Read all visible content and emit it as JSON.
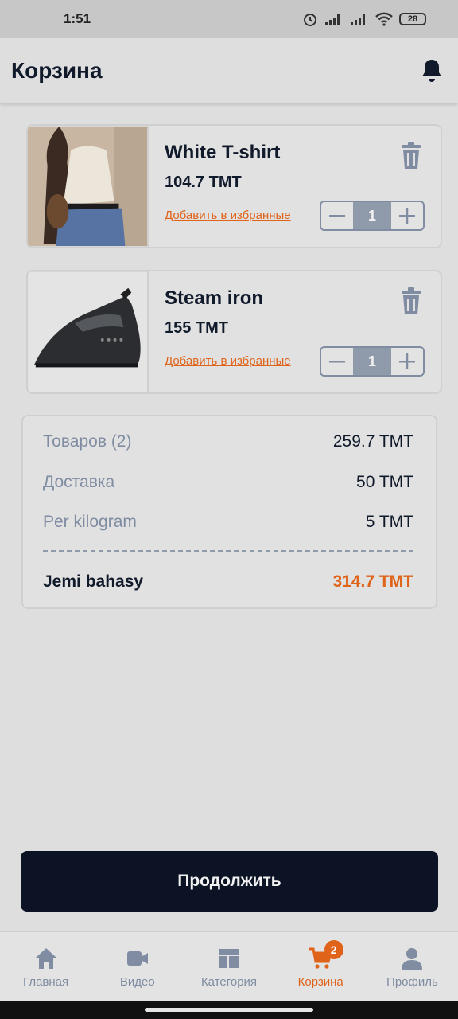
{
  "status": {
    "time": "1:51",
    "battery": "28"
  },
  "header": {
    "title": "Корзина"
  },
  "cart": {
    "items": [
      {
        "name": "White T-shirt",
        "price": "104.7 TMT",
        "fav_label": "Добавить в избранные",
        "qty": "1"
      },
      {
        "name": "Steam iron",
        "price": "155 TMT",
        "fav_label": "Добавить в избранные",
        "qty": "1"
      }
    ]
  },
  "summary": {
    "goods_label": "Товаров (2)",
    "goods_value": "259.7 TMT",
    "delivery_label": "Доставка",
    "delivery_value": "50 TMT",
    "per_kg_label": "Per kilogram",
    "per_kg_value": "5 TMT",
    "total_label": "Jemi bahasy",
    "total_value": "314.7 TMT"
  },
  "actions": {
    "continue_label": "Продолжить"
  },
  "nav": {
    "items": [
      {
        "label": "Главная",
        "icon": "home-icon"
      },
      {
        "label": "Видео",
        "icon": "video-icon"
      },
      {
        "label": "Категория",
        "icon": "category-icon"
      },
      {
        "label": "Корзина",
        "icon": "cart-icon",
        "badge": "2"
      },
      {
        "label": "Профиль",
        "icon": "profile-icon"
      }
    ]
  },
  "colors": {
    "accent": "#e0631a",
    "dark": "#0b1324",
    "muted": "#7f8ca1"
  }
}
